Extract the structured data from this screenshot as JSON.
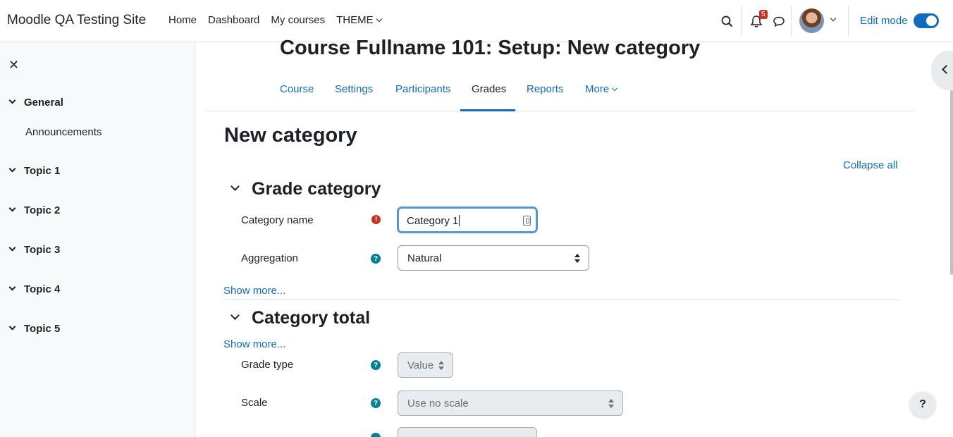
{
  "site": {
    "name": "Moodle QA Testing Site"
  },
  "primary_nav": {
    "home": "Home",
    "dashboard": "Dashboard",
    "my_courses": "My courses",
    "theme": "THEME"
  },
  "header": {
    "notification_count": "5",
    "edit_mode_label": "Edit mode",
    "edit_mode_on": true
  },
  "drawer": {
    "sections": [
      "General",
      "Topic 1",
      "Topic 2",
      "Topic 3",
      "Topic 4",
      "Topic 5"
    ],
    "general_item": "Announcements"
  },
  "course": {
    "title": "Course Fullname 101: Setup: New category"
  },
  "secondary_nav": {
    "tabs": [
      "Course",
      "Settings",
      "Participants",
      "Grades",
      "Reports",
      "More"
    ],
    "active": "Grades"
  },
  "page": {
    "heading": "New category",
    "collapse_all": "Collapse all"
  },
  "grade_category": {
    "header": "Grade category",
    "category_name_label": "Category name",
    "category_name_value": "Category 1",
    "aggregation_label": "Aggregation",
    "aggregation_value": "Natural",
    "show_more": "Show more..."
  },
  "category_total": {
    "header": "Category total",
    "show_more": "Show more...",
    "grade_type_label": "Grade type",
    "grade_type_value": "Value",
    "scale_label": "Scale",
    "scale_value": "Use no scale"
  },
  "help_fab": "?"
}
